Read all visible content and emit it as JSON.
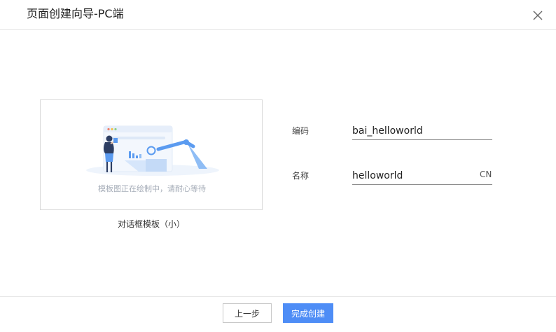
{
  "dialog": {
    "title": "页面创建向导-PC端",
    "close_icon": "close-icon"
  },
  "template": {
    "preview_loading_text": "模板图正在绘制中，请耐心等待",
    "name": "对话框模板（小）"
  },
  "form": {
    "code_label": "编码",
    "code_value": "bai_helloworld",
    "name_label": "名称",
    "name_value": "helloworld",
    "lang_tag": "CN"
  },
  "footer": {
    "prev_label": "上一步",
    "finish_label": "完成创建"
  },
  "colors": {
    "primary": "#4e8df6",
    "illustration_blue": "#5b9bf0",
    "illustration_light": "#d6e6fb"
  }
}
